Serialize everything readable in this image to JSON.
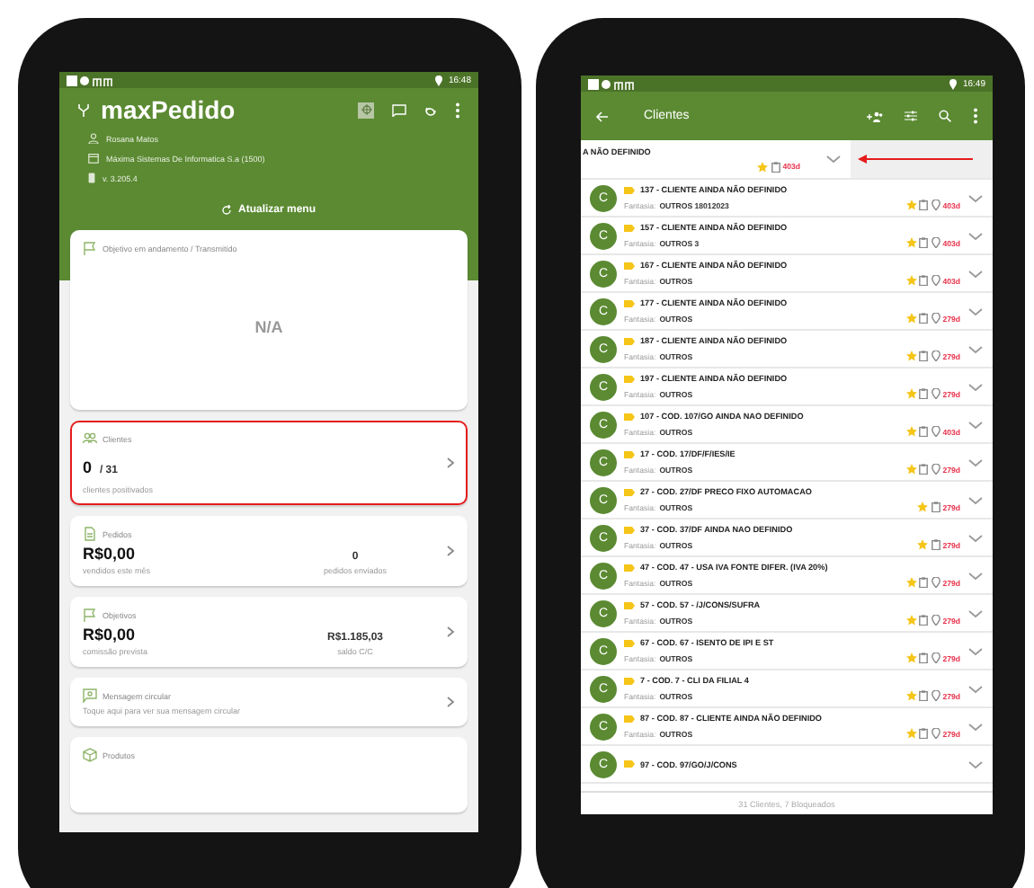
{
  "left_phone": {
    "status_bar": {
      "time": "16:48"
    },
    "app_title": "maxPedido",
    "user": "Rosana Matos",
    "company": "Máxima Sistemas De Informatica S.a (1500)",
    "version": "v. 3.205.4",
    "refresh_button": "Atualizar menu",
    "objective_card": {
      "title": "Objetivo em andamento / Transmitido",
      "value": "N/A"
    },
    "clients_card": {
      "title": "Clientes",
      "value": "0",
      "total": "/ 31",
      "caption": "clientes positivados",
      "highlighted": true
    },
    "orders_card": {
      "title": "Pedidos",
      "value": "R$0,00",
      "caption": "vendidos este mês",
      "side_value": "0",
      "side_caption": "pedidos enviados"
    },
    "goals_card": {
      "title": "Objetivos",
      "value": "R$0,00",
      "caption": "comissão prevista",
      "side_value": "R$1.185,03",
      "side_caption": "saldo C/C"
    },
    "message_card": {
      "title": "Mensagem circular",
      "text": "Toque aqui para ver sua mensagem circular"
    },
    "products_card": {
      "title": "Produtos"
    }
  },
  "right_phone": {
    "status_bar": {
      "time": "16:49"
    },
    "title": "Clientes",
    "swiped_row": {
      "title": "A NÃO DEFINIDO",
      "days": "403d",
      "annotated": true
    },
    "clients": [
      {
        "avatar": "C",
        "title": "137 - CLIENTE AINDA NÃO DEFINIDO",
        "fantasia_label": "Fantasia:",
        "fantasia": "OUTROS 18012023",
        "days": "403d",
        "location": true
      },
      {
        "avatar": "C",
        "title": "157 - CLIENTE AINDA NÃO DEFINIDO",
        "fantasia_label": "Fantasia:",
        "fantasia": "OUTROS 3",
        "days": "403d",
        "location": true
      },
      {
        "avatar": "C",
        "title": "167 - CLIENTE AINDA NÃO DEFINIDO",
        "fantasia_label": "Fantasia:",
        "fantasia": "OUTROS",
        "days": "403d",
        "location": true
      },
      {
        "avatar": "C",
        "title": "177 - CLIENTE AINDA NÃO DEFINIDO",
        "fantasia_label": "Fantasia:",
        "fantasia": "OUTROS",
        "days": "279d",
        "location": true
      },
      {
        "avatar": "C",
        "title": "187 - CLIENTE AINDA NÃO DEFINIDO",
        "fantasia_label": "Fantasia:",
        "fantasia": "OUTROS",
        "days": "279d",
        "location": true
      },
      {
        "avatar": "C",
        "title": "197 - CLIENTE AINDA NÃO DEFINIDO",
        "fantasia_label": "Fantasia:",
        "fantasia": "OUTROS",
        "days": "279d",
        "location": true
      },
      {
        "avatar": "C",
        "title": "107 - COD. 107/GO AINDA NAO DEFINIDO",
        "fantasia_label": "Fantasia:",
        "fantasia": "OUTROS",
        "days": "403d",
        "location": true
      },
      {
        "avatar": "C",
        "title": "17 - COD. 17/DF/F/IES/IE",
        "fantasia_label": "Fantasia:",
        "fantasia": "OUTROS",
        "days": "279d",
        "location": true
      },
      {
        "avatar": "C",
        "title": "27 - COD. 27/DF PRECO FIXO AUTOMACAO",
        "fantasia_label": "Fantasia:",
        "fantasia": "OUTROS",
        "days": "279d",
        "location": false
      },
      {
        "avatar": "C",
        "title": "37 - COD. 37/DF AINDA NAO DEFINIDO",
        "fantasia_label": "Fantasia:",
        "fantasia": "OUTROS",
        "days": "279d",
        "location": false
      },
      {
        "avatar": "C",
        "title": "47 - COD. 47 - USA IVA FONTE DIFER. (IVA 20%)",
        "fantasia_label": "Fantasia:",
        "fantasia": "OUTROS",
        "days": "279d",
        "location": true
      },
      {
        "avatar": "C",
        "title": "57 - COD. 57 - /J/CONS/SUFRA",
        "fantasia_label": "Fantasia:",
        "fantasia": "OUTROS",
        "days": "279d",
        "location": true
      },
      {
        "avatar": "C",
        "title": "67 - COD. 67 - ISENTO DE IPI E ST",
        "fantasia_label": "Fantasia:",
        "fantasia": "OUTROS",
        "days": "279d",
        "location": true
      },
      {
        "avatar": "C",
        "title": "7 - COD. 7 - CLI DA FILIAL 4",
        "fantasia_label": "Fantasia:",
        "fantasia": "OUTROS",
        "days": "279d",
        "location": true
      },
      {
        "avatar": "C",
        "title": "87 - COD. 87 - CLIENTE AINDA NÃO DEFINIDO",
        "fantasia_label": "Fantasia:",
        "fantasia": "OUTROS",
        "days": "279d",
        "location": true
      },
      {
        "avatar": "C",
        "title": "97 - COD. 97/GO/J/CONS"
      }
    ],
    "footer": "31 Clientes, 7 Bloqueados"
  }
}
